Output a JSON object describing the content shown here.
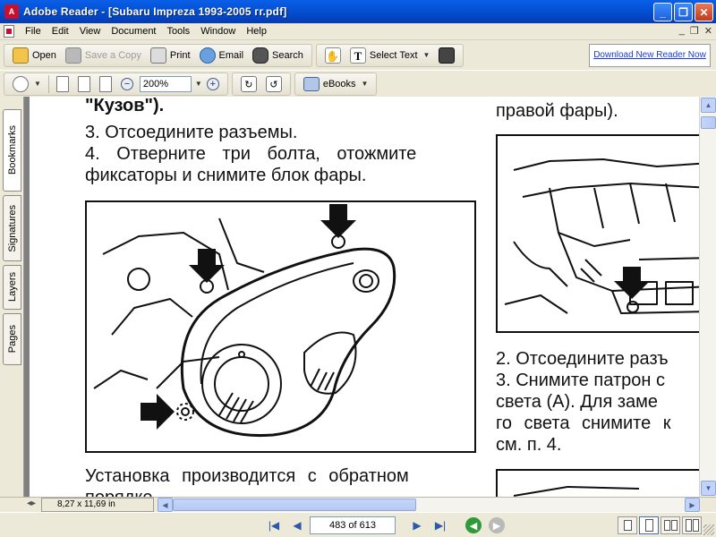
{
  "window": {
    "title": "Adobe Reader - [Subaru Impreza 1993-2005 гг.pdf]",
    "controls": {
      "minimize": "_",
      "maximize": "❐",
      "close": "✕"
    }
  },
  "menu": {
    "items": [
      "File",
      "Edit",
      "View",
      "Document",
      "Tools",
      "Window",
      "Help"
    ],
    "doc_controls": {
      "minimize": "_",
      "restore": "❐",
      "close": "✕"
    }
  },
  "toolbar1": {
    "open": "Open",
    "save_copy": "Save a Copy",
    "print": "Print",
    "email": "Email",
    "search": "Search",
    "select_text": "Select Text",
    "download_link": "Download New Reader Now"
  },
  "toolbar2": {
    "zoom_value": "200%",
    "ebooks": "eBooks"
  },
  "nav_tabs": [
    "Bookmarks",
    "Signatures",
    "Layers",
    "Pages"
  ],
  "document": {
    "left_column": [
      "\"Кузов\").",
      "3. Отсоедините разъемы.",
      "4. Отверните три болта, отожмите",
      "фиксаторы и снимите блок фары.",
      "Установка производится с обратном",
      "порядке."
    ],
    "right_column": [
      "правой фары).",
      "2. Отсоедините разъ",
      "3. Снимите патрон с",
      "света (А). Для заме",
      "го света снимите к",
      "см. п. 4."
    ]
  },
  "statusbar": {
    "page_size": "8,27 x 11,69 in"
  },
  "navigation": {
    "page_display": "483 of 613",
    "current_page": 483,
    "total_pages": 613
  },
  "colors": {
    "titlebar": "#0450d3",
    "chrome": "#ece9d8",
    "link": "#1a3ccf",
    "doc_background": "#808080"
  }
}
